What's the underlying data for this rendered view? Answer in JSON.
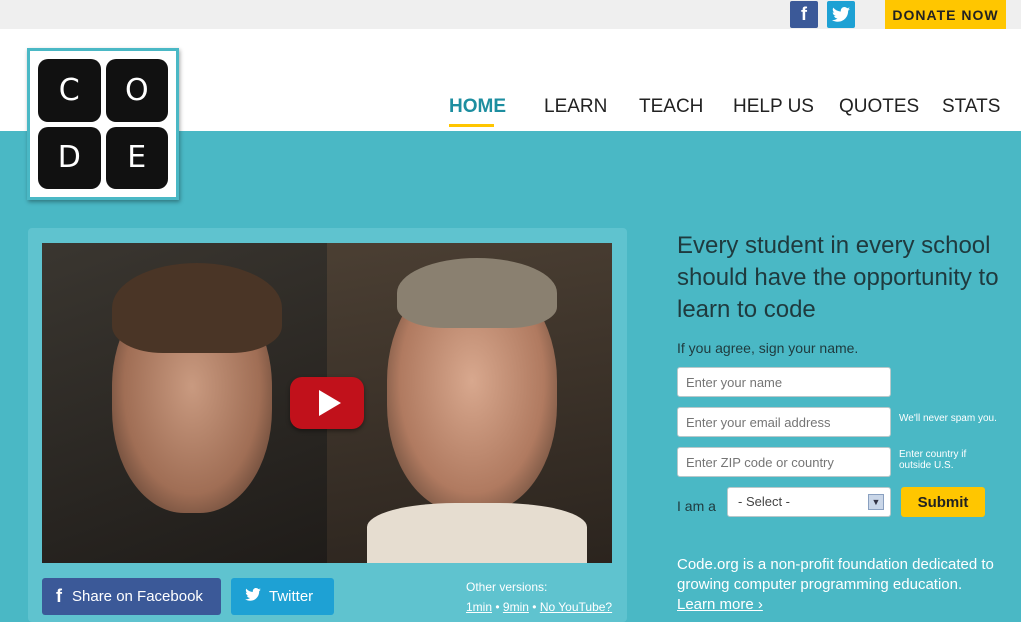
{
  "topbar": {
    "facebook_icon": "f",
    "twitter_icon": "twitter-bird",
    "donate_label": "DONATE NOW"
  },
  "logo": {
    "letters": [
      "C",
      "O",
      "D",
      "E"
    ]
  },
  "nav": {
    "items": [
      {
        "label": "HOME",
        "active": true
      },
      {
        "label": "LEARN"
      },
      {
        "label": "TEACH"
      },
      {
        "label": "HELP US"
      },
      {
        "label": "QUOTES"
      },
      {
        "label": "STATS"
      }
    ]
  },
  "video": {
    "share_facebook": "Share on Facebook",
    "share_twitter": "Twitter",
    "other_versions_label": "Other versions:",
    "version_1": "1min",
    "version_2": "9min",
    "version_3": "No YouTube?",
    "separator": "•"
  },
  "signup": {
    "headline": "Every student in every school should have the opportunity to learn to code",
    "sign_label": "If you agree, sign your name.",
    "name_placeholder": "Enter your name",
    "email_placeholder": "Enter your email address",
    "email_hint": "We'll never spam you.",
    "zip_placeholder": "Enter ZIP code or country",
    "zip_hint": "Enter country if outside U.S.",
    "iam_label": "I am a",
    "select_value": "- Select -",
    "submit_label": "Submit"
  },
  "about": {
    "text": "Code.org is a non-profit foundation dedicated to growing computer programming education.",
    "learn_more": "Learn more ›"
  },
  "colors": {
    "accent": "#4ab8c5",
    "donate": "#ffc600",
    "facebook": "#3b5998",
    "twitter": "#1ea1d4"
  }
}
